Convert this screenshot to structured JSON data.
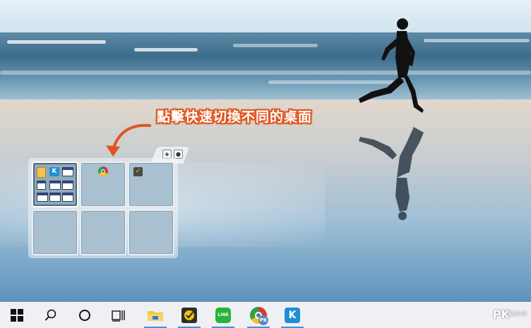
{
  "annotation": {
    "caption": "點擊快速切換不同的桌面"
  },
  "switcher": {
    "selected_desktop": 1,
    "desktops": [
      {
        "id": 1,
        "icons": [
          "folder-icon",
          "kkbox-icon",
          "window-icon",
          "window-icon",
          "window-icon",
          "window-icon",
          "window-icon",
          "window-icon"
        ]
      },
      {
        "id": 2,
        "icons": [
          "chrome-icon"
        ]
      },
      {
        "id": 3,
        "icons": [
          "norton-icon"
        ]
      },
      {
        "id": 4,
        "icons": []
      },
      {
        "id": 5,
        "icons": []
      },
      {
        "id": 6,
        "icons": []
      }
    ],
    "controls": [
      "settings-icon",
      "close-icon"
    ]
  },
  "taskbar": {
    "items": [
      {
        "name": "start-button",
        "icon": "windows-logo-icon"
      },
      {
        "name": "search-button",
        "icon": "search-icon"
      },
      {
        "name": "cortana-button",
        "icon": "cortana-circle-icon"
      },
      {
        "name": "task-view-button",
        "icon": "task-view-icon"
      },
      {
        "name": "file-explorer-button",
        "icon": "folder-icon"
      },
      {
        "name": "norton-button",
        "icon": "norton-icon"
      },
      {
        "name": "line-button",
        "icon": "line-icon",
        "label": "LINE"
      },
      {
        "name": "chrome-button",
        "icon": "chrome-icon",
        "badge": "PK"
      },
      {
        "name": "kkbox-button",
        "icon": "kkbox-icon",
        "label": "K"
      }
    ],
    "brand": "PK",
    "brand_sub": "電腦科技"
  },
  "colors": {
    "accent": "#e0551f",
    "taskbar": "#eef0f3",
    "active_indicator": "#4a8fd8"
  }
}
